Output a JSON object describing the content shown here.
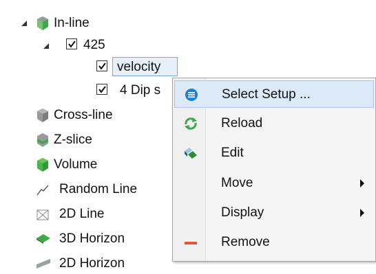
{
  "tree": {
    "inline": "In-line",
    "n425": "425",
    "velocity": "velocity",
    "dip": "4 Dip s",
    "crossline": "Cross-line",
    "zslice": "Z-slice",
    "volume": "Volume",
    "randomline": "Random Line",
    "line2d": "2D Line",
    "horizon3d": "3D Horizon",
    "horizon2d": "2D Horizon"
  },
  "menu": {
    "items": [
      {
        "label": "Select Setup ...",
        "icon": "list-circle-icon"
      },
      {
        "label": "Reload",
        "icon": "reload-icon"
      },
      {
        "label": "Edit",
        "icon": "edit-icon"
      },
      {
        "label": "Move",
        "icon": ""
      },
      {
        "label": "Display",
        "icon": ""
      },
      {
        "label": "Remove",
        "icon": "remove-icon"
      }
    ]
  },
  "colors": {
    "green": "#3ea84a",
    "blue": "#1c7fd6",
    "red": "#e05a3a"
  }
}
